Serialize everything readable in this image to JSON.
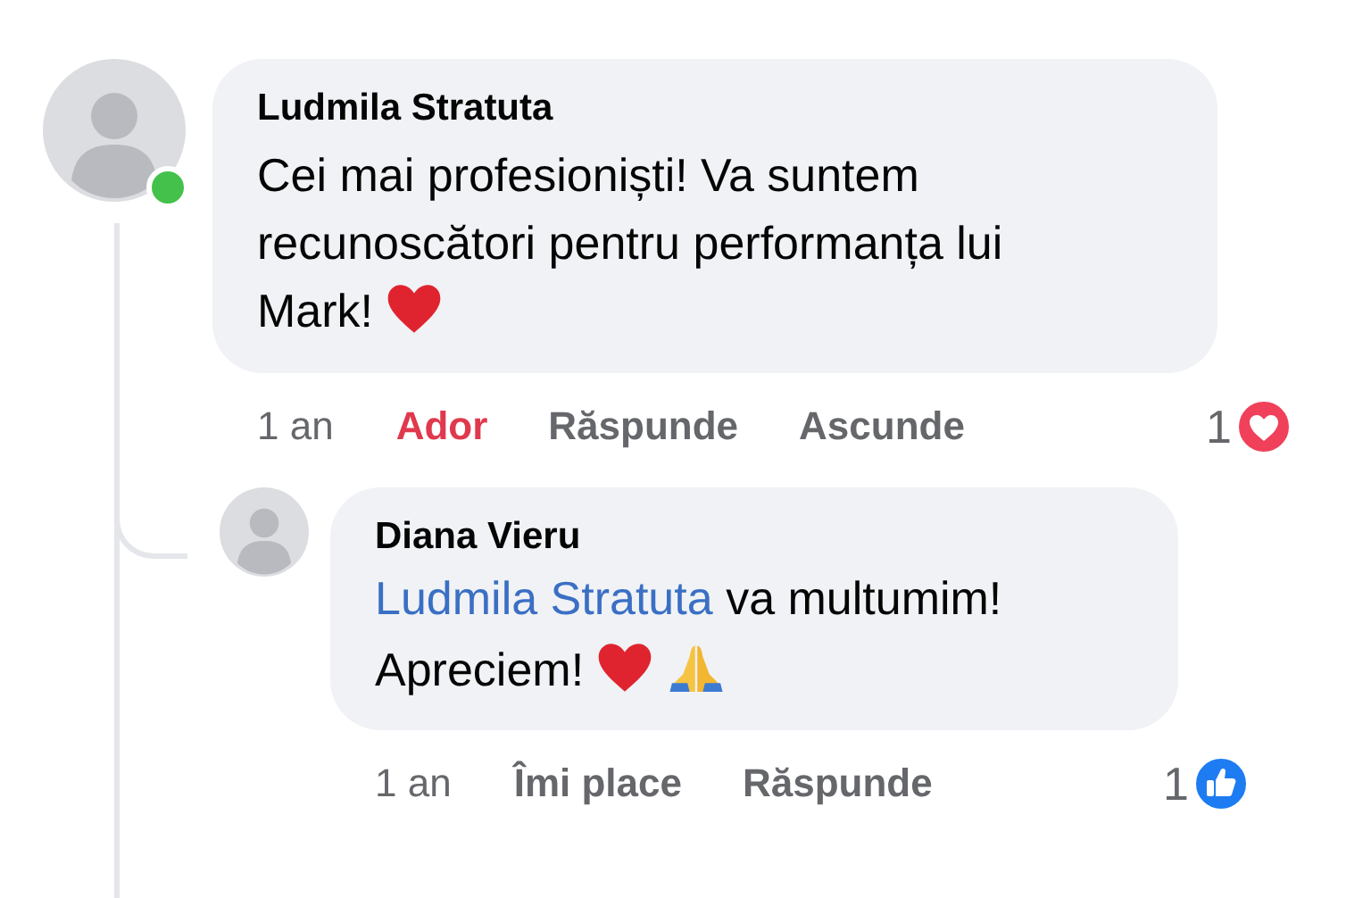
{
  "comments": [
    {
      "author": "Ludmila Stratuta",
      "online": true,
      "text": "Cei mai profesioniști! Va suntem recunoscători pentru performanța lui Mark!",
      "emojis": [
        {
          "kind": "heart"
        }
      ],
      "time": "1 an",
      "reacted": true,
      "react_label": "Ador",
      "actions": [
        "Răspunde",
        "Ascunde"
      ],
      "reaction": {
        "count": "1",
        "kind": "love"
      },
      "replies": [
        {
          "author": "Diana Vieru",
          "mention": "Ludmila Stratuta",
          "text": "va multumim! Apreciem!",
          "emojis": [
            {
              "kind": "heart"
            },
            {
              "kind": "pray"
            }
          ],
          "time": "1 an",
          "reacted": false,
          "react_label": "Îmi place",
          "actions": [
            "Răspunde"
          ],
          "reaction": {
            "count": "1",
            "kind": "like"
          }
        }
      ]
    }
  ]
}
